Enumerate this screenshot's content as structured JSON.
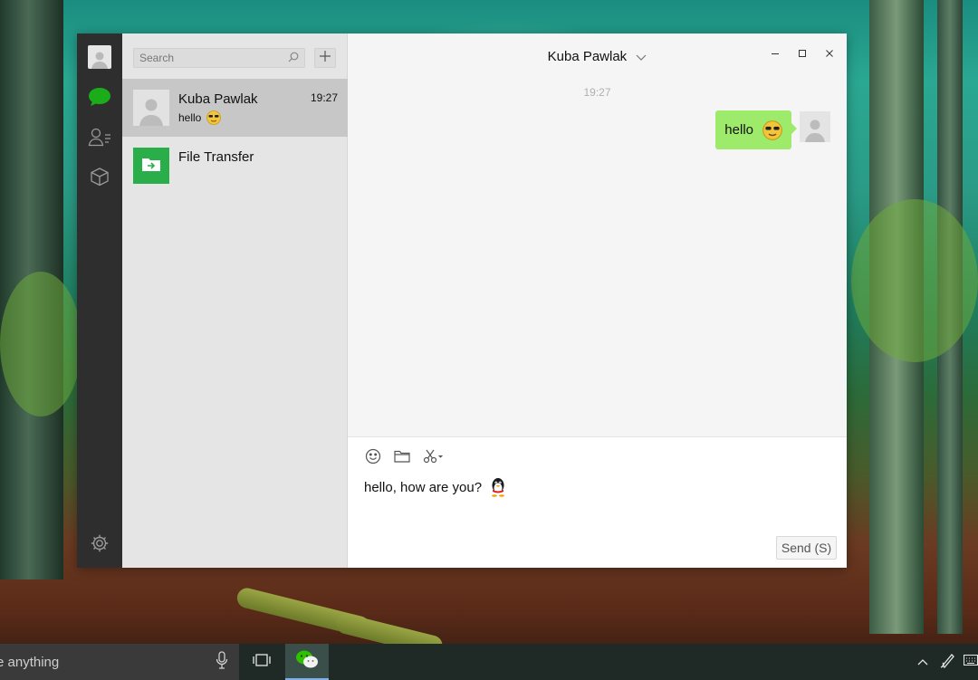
{
  "wechat": {
    "search": {
      "placeholder": "Search"
    },
    "chats": [
      {
        "name": "Kuba Pawlak",
        "preview": "hello",
        "time": "19:27",
        "active": true
      },
      {
        "name": "File Transfer",
        "preview": "",
        "time": "",
        "active": false
      }
    ],
    "conversation": {
      "contact_name": "Kuba Pawlak",
      "timestamp": "19:27",
      "messages": [
        {
          "from": "me",
          "text": "hello",
          "emoji": "cool-face"
        }
      ]
    },
    "composer": {
      "draft_text": "hello, how are you?",
      "draft_emoji": "penguin",
      "send_label": "Send (S)"
    },
    "colors": {
      "accent": "#2aae4a",
      "bubble": "#9eea6a",
      "nav_bg": "#2e2e2e"
    }
  },
  "taskbar": {
    "search_text": "e anything"
  }
}
